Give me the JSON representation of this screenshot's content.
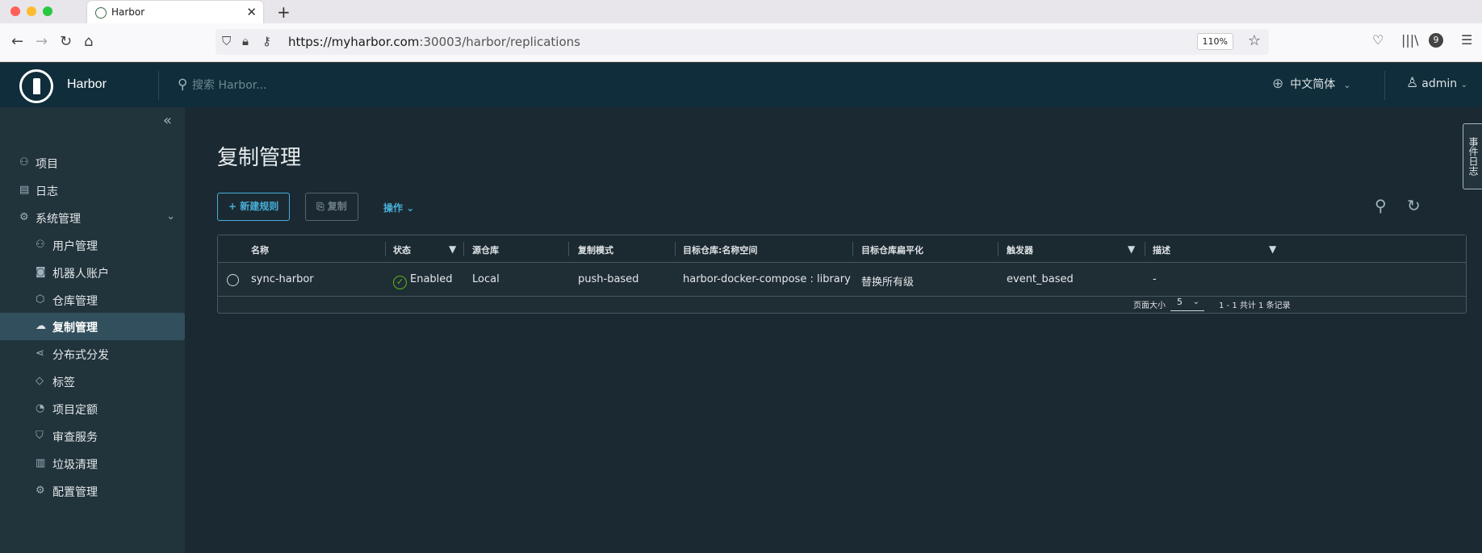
{
  "browser": {
    "tab_title": "Harbor",
    "url_host": "https://myharbor.com",
    "url_path": ":30003/harbor/replications",
    "zoom": "110%",
    "badge_count": "9"
  },
  "header": {
    "brand": "Harbor",
    "search_placeholder": "搜索 Harbor...",
    "language": "中文简体",
    "user": "admin"
  },
  "sidebar": {
    "items": [
      {
        "label": "项目",
        "icon": "project-icon"
      },
      {
        "label": "日志",
        "icon": "log-icon"
      },
      {
        "label": "系统管理",
        "icon": "admin-icon"
      },
      {
        "label": "用户管理",
        "icon": "users-icon"
      },
      {
        "label": "机器人账户",
        "icon": "robot-icon"
      },
      {
        "label": "仓库管理",
        "icon": "registry-icon"
      },
      {
        "label": "复制管理",
        "icon": "replication-icon"
      },
      {
        "label": "分布式分发",
        "icon": "distribution-icon"
      },
      {
        "label": "标签",
        "icon": "tag-icon"
      },
      {
        "label": "项目定额",
        "icon": "quota-icon"
      },
      {
        "label": "审查服务",
        "icon": "shield-icon"
      },
      {
        "label": "垃圾清理",
        "icon": "trash-icon"
      },
      {
        "label": "配置管理",
        "icon": "gear-icon"
      }
    ]
  },
  "main": {
    "title": "复制管理",
    "new_rule_label": "新建规则",
    "copy_label": "复制",
    "ops_label": "操作",
    "side_tab": "事件日志",
    "columns": [
      "名称",
      "状态",
      "源仓库",
      "复制模式",
      "目标仓库:名称空间",
      "目标仓库扁平化",
      "触发器",
      "描述"
    ],
    "rows": [
      {
        "name": "sync-harbor",
        "status": "Enabled",
        "source": "Local",
        "mode": "push-based",
        "dest": "harbor-docker-compose : library",
        "flatten": "替换所有级",
        "trigger": "event_based",
        "desc": "-"
      }
    ],
    "page_size_label": "页面大小",
    "page_size": "5",
    "count_text": "1 - 1 共计 1 条记录"
  },
  "colors": {
    "header_bg": "#0f2d3a",
    "sidebar_bg": "#21333b",
    "main_bg": "#1b2a32",
    "accent": "#49afd9",
    "success": "#60b515"
  }
}
